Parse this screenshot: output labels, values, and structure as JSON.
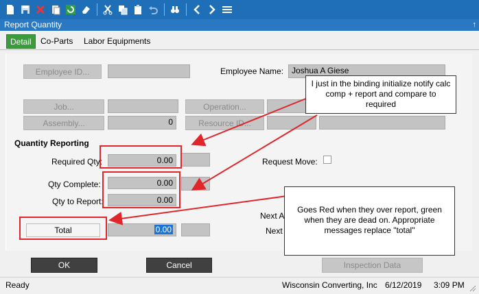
{
  "toolbar": {
    "icons": [
      "new-icon",
      "save-icon",
      "delete-icon",
      "paste-icon",
      "refresh-icon",
      "clear-icon",
      "cut-icon",
      "copy-icon",
      "clipboard-icon",
      "undo-icon",
      "binoculars-icon",
      "back-icon",
      "forward-icon",
      "menu-icon"
    ]
  },
  "window": {
    "title": "Report Quantity",
    "pin": "↑"
  },
  "tabs": [
    {
      "label": "Detail"
    },
    {
      "label": "Co-Parts"
    },
    {
      "label": "Labor Equipments"
    }
  ],
  "form": {
    "employee_id_btn": "Employee ID...",
    "employee_name_label": "Employee Name:",
    "employee_name_value": "Joshua A Giese",
    "job_btn": "Job...",
    "operation_btn": "Operation...",
    "assembly_btn": "Assembly...",
    "assembly_value": "0",
    "resource_btn": "Resource ID...",
    "qty_section": "Quantity Reporting",
    "required_qty_label": "Required Qty:",
    "required_qty_value": "0.00",
    "request_move_label": "Request Move:",
    "qty_complete_label": "Qty Complete:",
    "qty_complete_value": "0.00",
    "qty_report_label": "Qty to Report:",
    "qty_report_value": "0.00",
    "total_btn": "Total",
    "total_value": "0.00",
    "next_a_label": "Next A",
    "next_label": "Next"
  },
  "callouts": {
    "top": "I just in the binding initialize notify calc comp + report and compare to required",
    "bottom": "Goes Red when they over report, green when they are dead on. Appropriate messages replace \"total\""
  },
  "actions": {
    "ok": "OK",
    "cancel": "Cancel",
    "inspection": "Inspection Data"
  },
  "status": {
    "ready": "Ready",
    "company": "Wisconsin Converting, Inc",
    "date": "6/12/2019",
    "time": "3:09 PM"
  },
  "colors": {
    "toolbar": "#1e6fb8",
    "tab_active": "#3c9b3c",
    "annotation": "#e0262b",
    "selection": "#1a73d8"
  }
}
